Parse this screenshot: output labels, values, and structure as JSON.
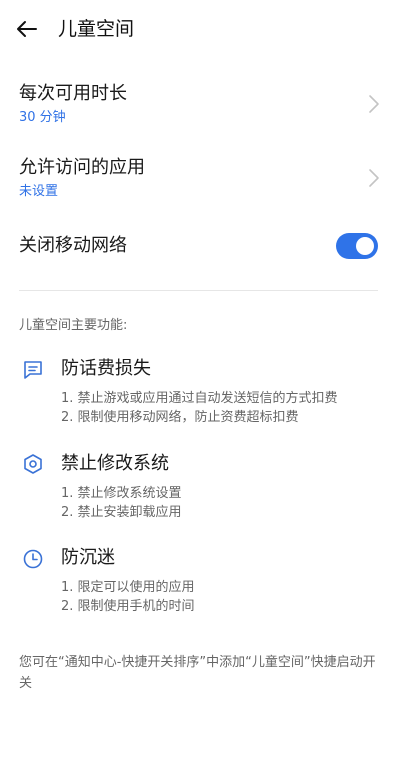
{
  "header": {
    "title": "儿童空间",
    "back_icon": "arrow-left-icon"
  },
  "settings": {
    "duration": {
      "title": "每次可用时长",
      "value": "30 分钟"
    },
    "allowed_apps": {
      "title": "允许访问的应用",
      "value": "未设置"
    },
    "mobile_network": {
      "title": "关闭移动网络",
      "enabled": true
    }
  },
  "features": {
    "heading": "儿童空间主要功能:",
    "items": [
      {
        "icon": "message-icon",
        "title": "防话费损失",
        "lines": [
          "1. 禁止游戏或应用通过自动发送短信的方式扣费",
          "2. 限制使用移动网络，防止资费超标扣费"
        ]
      },
      {
        "icon": "settings-hexagon-icon",
        "title": "禁止修改系统",
        "lines": [
          "1. 禁止修改系统设置",
          "2. 禁止安装卸载应用"
        ]
      },
      {
        "icon": "clock-icon",
        "title": "防沉迷",
        "lines": [
          "1. 限定可以使用的应用",
          "2. 限制使用手机的时间"
        ]
      }
    ]
  },
  "footer": {
    "note": "您可在“通知中心-快捷开关排序”中添加“儿童空间”快捷启动开关"
  },
  "colors": {
    "accent": "#2f73e8",
    "link_text": "#3072e6",
    "secondary_text": "#666666"
  }
}
